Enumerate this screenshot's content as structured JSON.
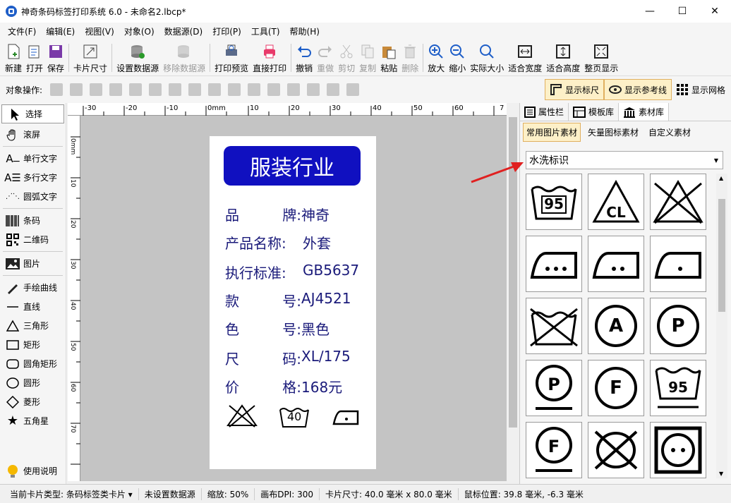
{
  "window": {
    "title": "神奇条码标签打印系统 6.0 - 未命名2.lbcp*",
    "minimize": "—",
    "maximize": "☐",
    "close": "✕"
  },
  "menu": [
    "文件(F)",
    "编辑(E)",
    "视图(V)",
    "对象(O)",
    "数据源(D)",
    "打印(P)",
    "工具(T)",
    "帮助(H)"
  ],
  "toolbar": [
    "新建",
    "打开",
    "保存",
    "卡片尺寸",
    "设置数据源",
    "移除数据源",
    "打印预览",
    "直接打印",
    "撤销",
    "重做",
    "剪切",
    "复制",
    "粘贴",
    "删除",
    "放大",
    "缩小",
    "实际大小",
    "适合宽度",
    "适合高度",
    "整页显示"
  ],
  "objbar": {
    "label": "对象操作:",
    "show_ruler": "显示标尺",
    "show_guides": "显示参考线",
    "show_grid": "显示网格"
  },
  "tools": [
    "选择",
    "滚屏",
    "单行文字",
    "多行文字",
    "圆弧文字",
    "条码",
    "二维码",
    "图片",
    "手绘曲线",
    "直线",
    "三角形",
    "矩形",
    "圆角矩形",
    "圆形",
    "菱形",
    "五角星"
  ],
  "help": "使用说明",
  "ruler_h": [
    "-30",
    "-20",
    "-10",
    "0mm",
    "10",
    "20",
    "30",
    "40",
    "50",
    "60",
    "7"
  ],
  "ruler_v": [
    "0mm",
    "10",
    "20",
    "30",
    "40",
    "50",
    "60",
    "70"
  ],
  "label": {
    "header": "服装行业",
    "rows": [
      {
        "k1": "品",
        "k2": "牌:",
        "v": "神奇"
      },
      {
        "k1": "产品名称:",
        "k2": "",
        "v": "外套"
      },
      {
        "k1": "执行标准:",
        "k2": "",
        "v": "GB5637"
      },
      {
        "k1": "款",
        "k2": "号:",
        "v": "AJ4521"
      },
      {
        "k1": "色",
        "k2": "号:",
        "v": "黑色"
      },
      {
        "k1": "尺",
        "k2": "码:",
        "v": "XL/175"
      },
      {
        "k1": "价",
        "k2": "格:",
        "v": "168元"
      }
    ],
    "icon_wash_temp": "40"
  },
  "right": {
    "tabs": [
      "属性栏",
      "模板库",
      "素材库"
    ],
    "subtabs": [
      "常用图片素材",
      "矢量图标素材",
      "自定义素材"
    ],
    "combo_value": "水洗标识",
    "cells": [
      "95",
      "CL",
      "",
      "",
      "",
      "",
      "",
      "A",
      "P",
      "P",
      "F",
      "95",
      "F",
      "",
      ""
    ]
  },
  "status": {
    "card_type": "当前卡片类型: 条码标签类卡片 ▾",
    "datasource": "未设置数据源",
    "zoom": "缩放: 50%",
    "dpi": "画布DPI: 300",
    "card_size": "卡片尺寸: 40.0 毫米 x 80.0 毫米",
    "mouse": "鼠标位置: 39.8 毫米, -6.3 毫米"
  }
}
